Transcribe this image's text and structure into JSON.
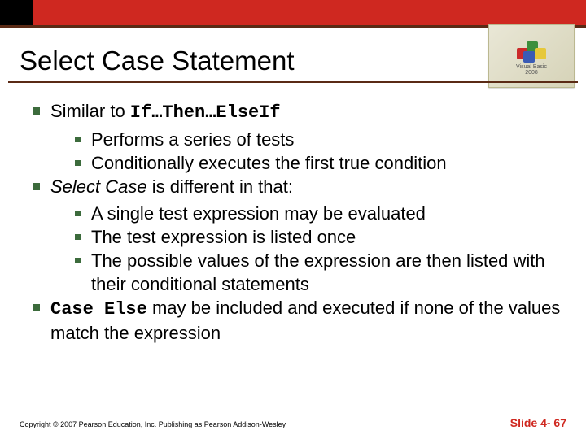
{
  "logo": {
    "line1": "Visual Basic",
    "line2": "2008"
  },
  "title": "Select Case Statement",
  "b1_pre": "Similar to ",
  "b1_code": "If…Then…ElseIf",
  "b1a": "Performs a series of tests",
  "b1b": "Conditionally executes the first true condition",
  "b2_ital": "Select Case",
  "b2_post": " is different in that:",
  "b2a": "A single test expression may be evaluated",
  "b2b": "The test expression is listed once",
  "b2c": "The possible values of the expression are then listed with their conditional statements",
  "b3_code": "Case Else",
  "b3_post": " may be included and executed if none of the values match the expression",
  "copyright": "Copyright © 2007 Pearson Education, Inc. Publishing as Pearson Addison-Wesley",
  "slidenum": "Slide 4- 67"
}
